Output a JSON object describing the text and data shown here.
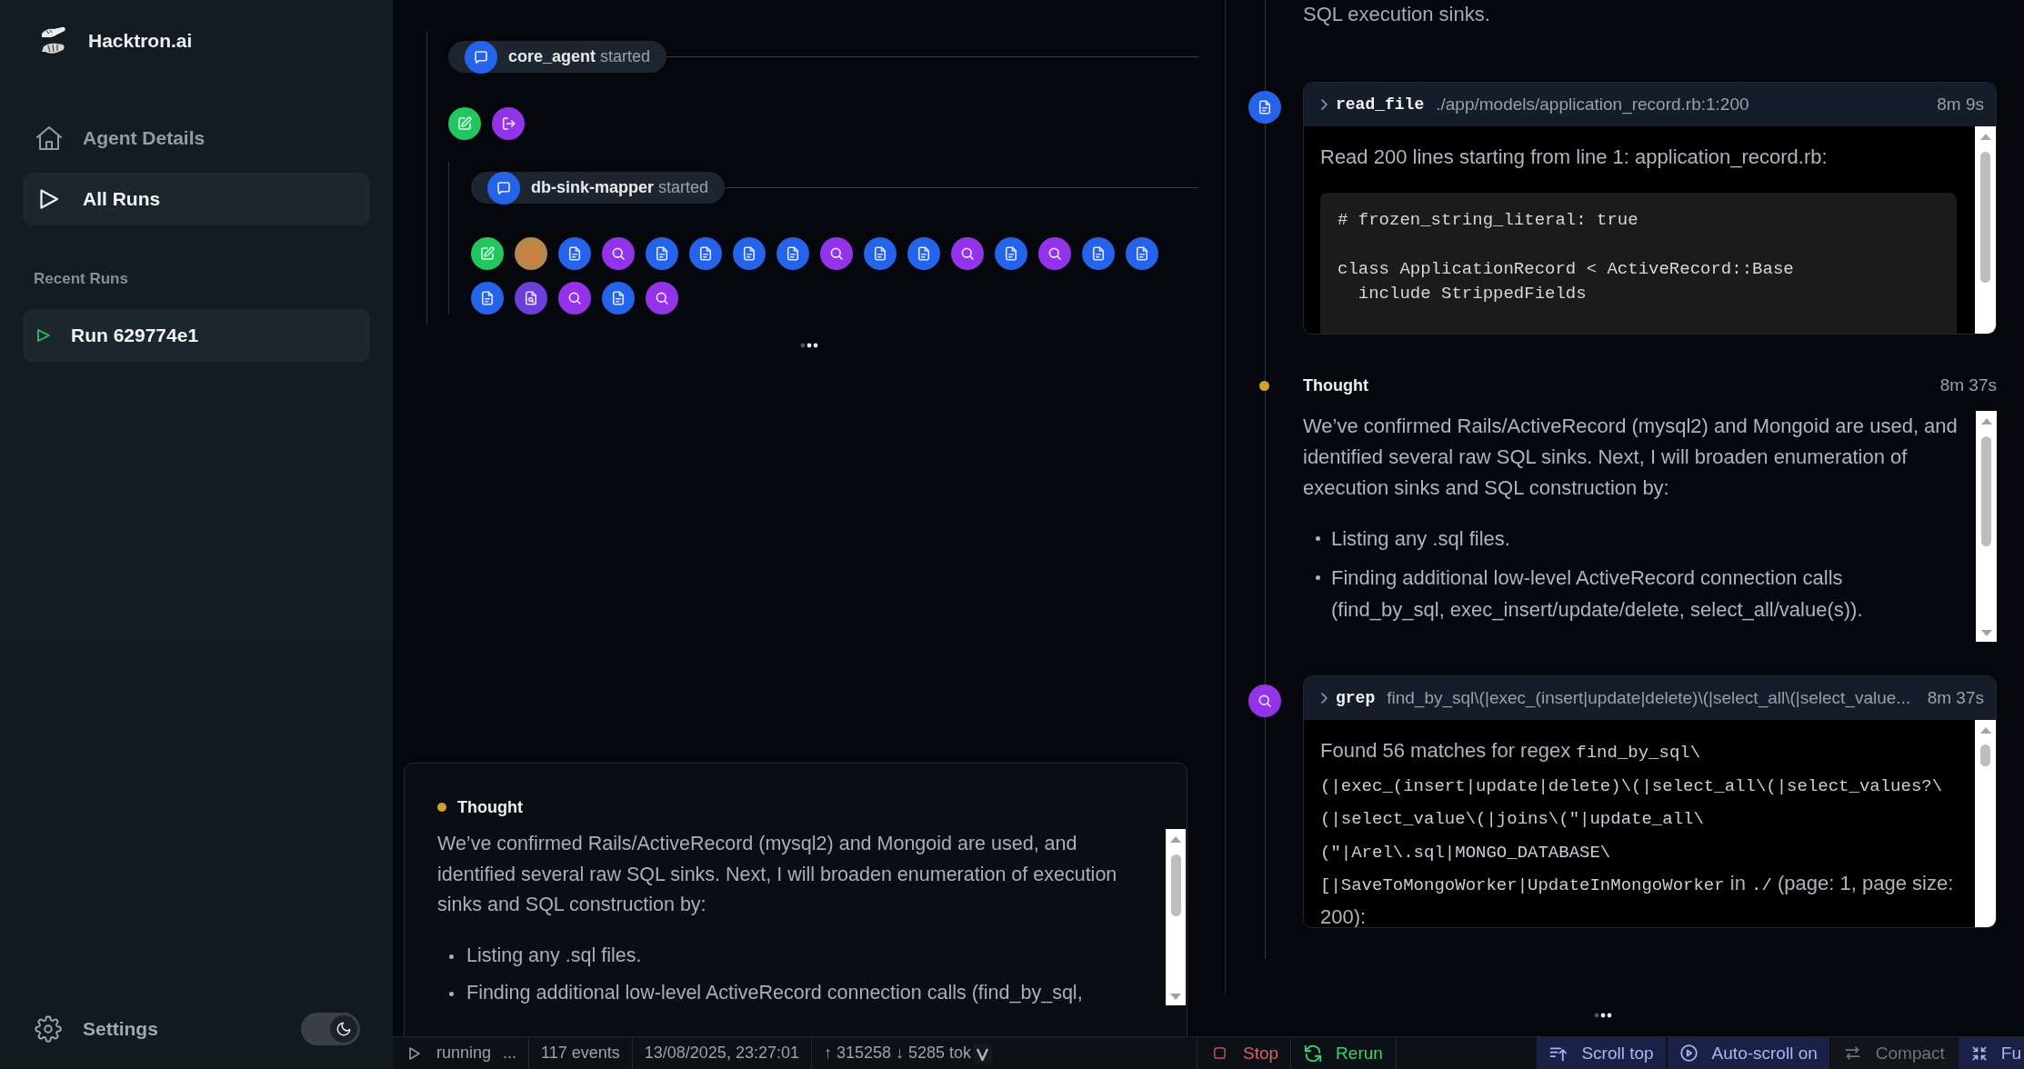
{
  "sidebar": {
    "brand": "Hacktron.ai",
    "nav": [
      {
        "kind": "home",
        "label": "Agent Details",
        "selected": false
      },
      {
        "kind": "play",
        "label": "All Runs",
        "selected": true
      }
    ],
    "recent_title": "Recent Runs",
    "recent_runs": [
      {
        "label": "Run 629774e1",
        "selected": true
      }
    ],
    "settings": "Settings",
    "theme_toggle": {
      "on": true
    }
  },
  "timeline": {
    "agents": [
      {
        "name": "core_agent",
        "status": "started",
        "events": [
          {
            "kind": "edit",
            "color": "#22c55e"
          },
          {
            "kind": "exit",
            "color": "#9333ea"
          }
        ],
        "children": [
          {
            "name": "db-sink-mapper",
            "status": "started",
            "events": [
              {
                "kind": "edit",
                "color": "#22c55e"
              },
              {
                "kind": "folder",
                "color": "#b9864c"
              },
              {
                "kind": "file",
                "color": "#2563eb"
              },
              {
                "kind": "search",
                "color": "#9333ea"
              },
              {
                "kind": "file",
                "color": "#2563eb"
              },
              {
                "kind": "file",
                "color": "#2563eb"
              },
              {
                "kind": "file",
                "color": "#2563eb"
              },
              {
                "kind": "file",
                "color": "#2563eb"
              },
              {
                "kind": "search",
                "color": "#9333ea"
              },
              {
                "kind": "file",
                "color": "#2563eb"
              },
              {
                "kind": "file",
                "color": "#2563eb"
              },
              {
                "kind": "search",
                "color": "#9333ea"
              },
              {
                "kind": "file",
                "color": "#2563eb"
              },
              {
                "kind": "search",
                "color": "#9333ea"
              },
              {
                "kind": "file",
                "color": "#2563eb"
              },
              {
                "kind": "file",
                "color": "#2563eb"
              },
              {
                "kind": "file",
                "color": "#2563eb"
              },
              {
                "kind": "file_search",
                "color": "#6d3fd8"
              },
              {
                "kind": "search",
                "color": "#9333ea"
              },
              {
                "kind": "file",
                "color": "#2563eb"
              },
              {
                "kind": "search",
                "color": "#9333ea"
              }
            ]
          }
        ]
      }
    ]
  },
  "thought_card": {
    "title": "Thought",
    "text": "We’ve confirmed Rails/ActiveRecord (mysql2) and Mongoid are used, and identified several raw SQL sinks. Next, I will broaden enumeration of execution sinks and SQL construction by:",
    "bullets": [
      "Listing any .sql files.",
      "Finding additional low-level ActiveRecord connection calls (find_by_sql,"
    ]
  },
  "log": {
    "leading_text": "SQL execution sinks.",
    "entries": [
      {
        "kind": "file_tool",
        "color": "#2563eb",
        "name": "read_file",
        "args": "./app/models/application_record.rb:1:200",
        "time": "8m 9s",
        "output": [
          {
            "kind": "paragraph",
            "parts": [
              {
                "kind": "text",
                "text": "Read 200 lines starting from line 1: application_record.rb:"
              }
            ]
          },
          {
            "kind": "code_block",
            "text": "# frozen_string_literal: true\n\nclass ApplicationRecord < ActiveRecord::Base\n  include StrippedFields"
          }
        ]
      },
      {
        "kind": "thought",
        "color": "#d0a22a",
        "title": "Thought",
        "time": "8m 37s",
        "text": "We’ve confirmed Rails/ActiveRecord (mysql2) and Mongoid are used, and identified several raw SQL sinks. Next, I will broaden enumeration of execution sinks and SQL construction by:",
        "bullets": [
          "Listing any .sql files.",
          "Finding additional low-level ActiveRecord connection calls (find_by_sql, exec_insert/update/delete, select_all/value(s))."
        ]
      },
      {
        "kind": "search_tool",
        "color": "#9333ea",
        "name": "grep",
        "args": "find_by_sql\\(|exec_(insert|update|delete)\\(|select_all\\(|select_value...",
        "time": "8m 37s",
        "output": [
          {
            "kind": "paragraph",
            "parts": [
              {
                "kind": "text",
                "text": "Found 56 matches for regex"
              },
              {
                "kind": "code",
                "text": "find_by_sql\\(|exec_(insert|update|delete)\\(|select_all\\(|select_values?\\(|select_value\\(|joins\\(\"|update_all\\(\"|Arel\\.sql|MONGO_DATABASE\\[|SaveToMongoWorker|UpdateInMongoWorker"
              },
              {
                "kind": "text",
                "text": "in"
              },
              {
                "kind": "code",
                "text": "./"
              },
              {
                "kind": "text",
                "text": "(page: 1, page size: 200):"
              }
            ]
          }
        ]
      }
    ]
  },
  "status_bar": {
    "run_state": "running",
    "run_state_suffix": "...",
    "events": "117 events",
    "timestamp": "13/08/2025, 23:27:01",
    "tokens": "↑ 315258 ↓ 5285 tok",
    "actions": [
      {
        "kind": "stop",
        "label": "Stop"
      },
      {
        "kind": "rerun",
        "label": "Rerun"
      }
    ],
    "view_controls": [
      {
        "kind": "scroll_top",
        "label": "Scroll top",
        "active": true
      },
      {
        "kind": "auto_scroll",
        "label": "Auto-scroll on",
        "active": true
      },
      {
        "kind": "compact",
        "label": "Compact",
        "active": false
      },
      {
        "kind": "collapse",
        "label": "Fu",
        "active": true
      }
    ]
  }
}
